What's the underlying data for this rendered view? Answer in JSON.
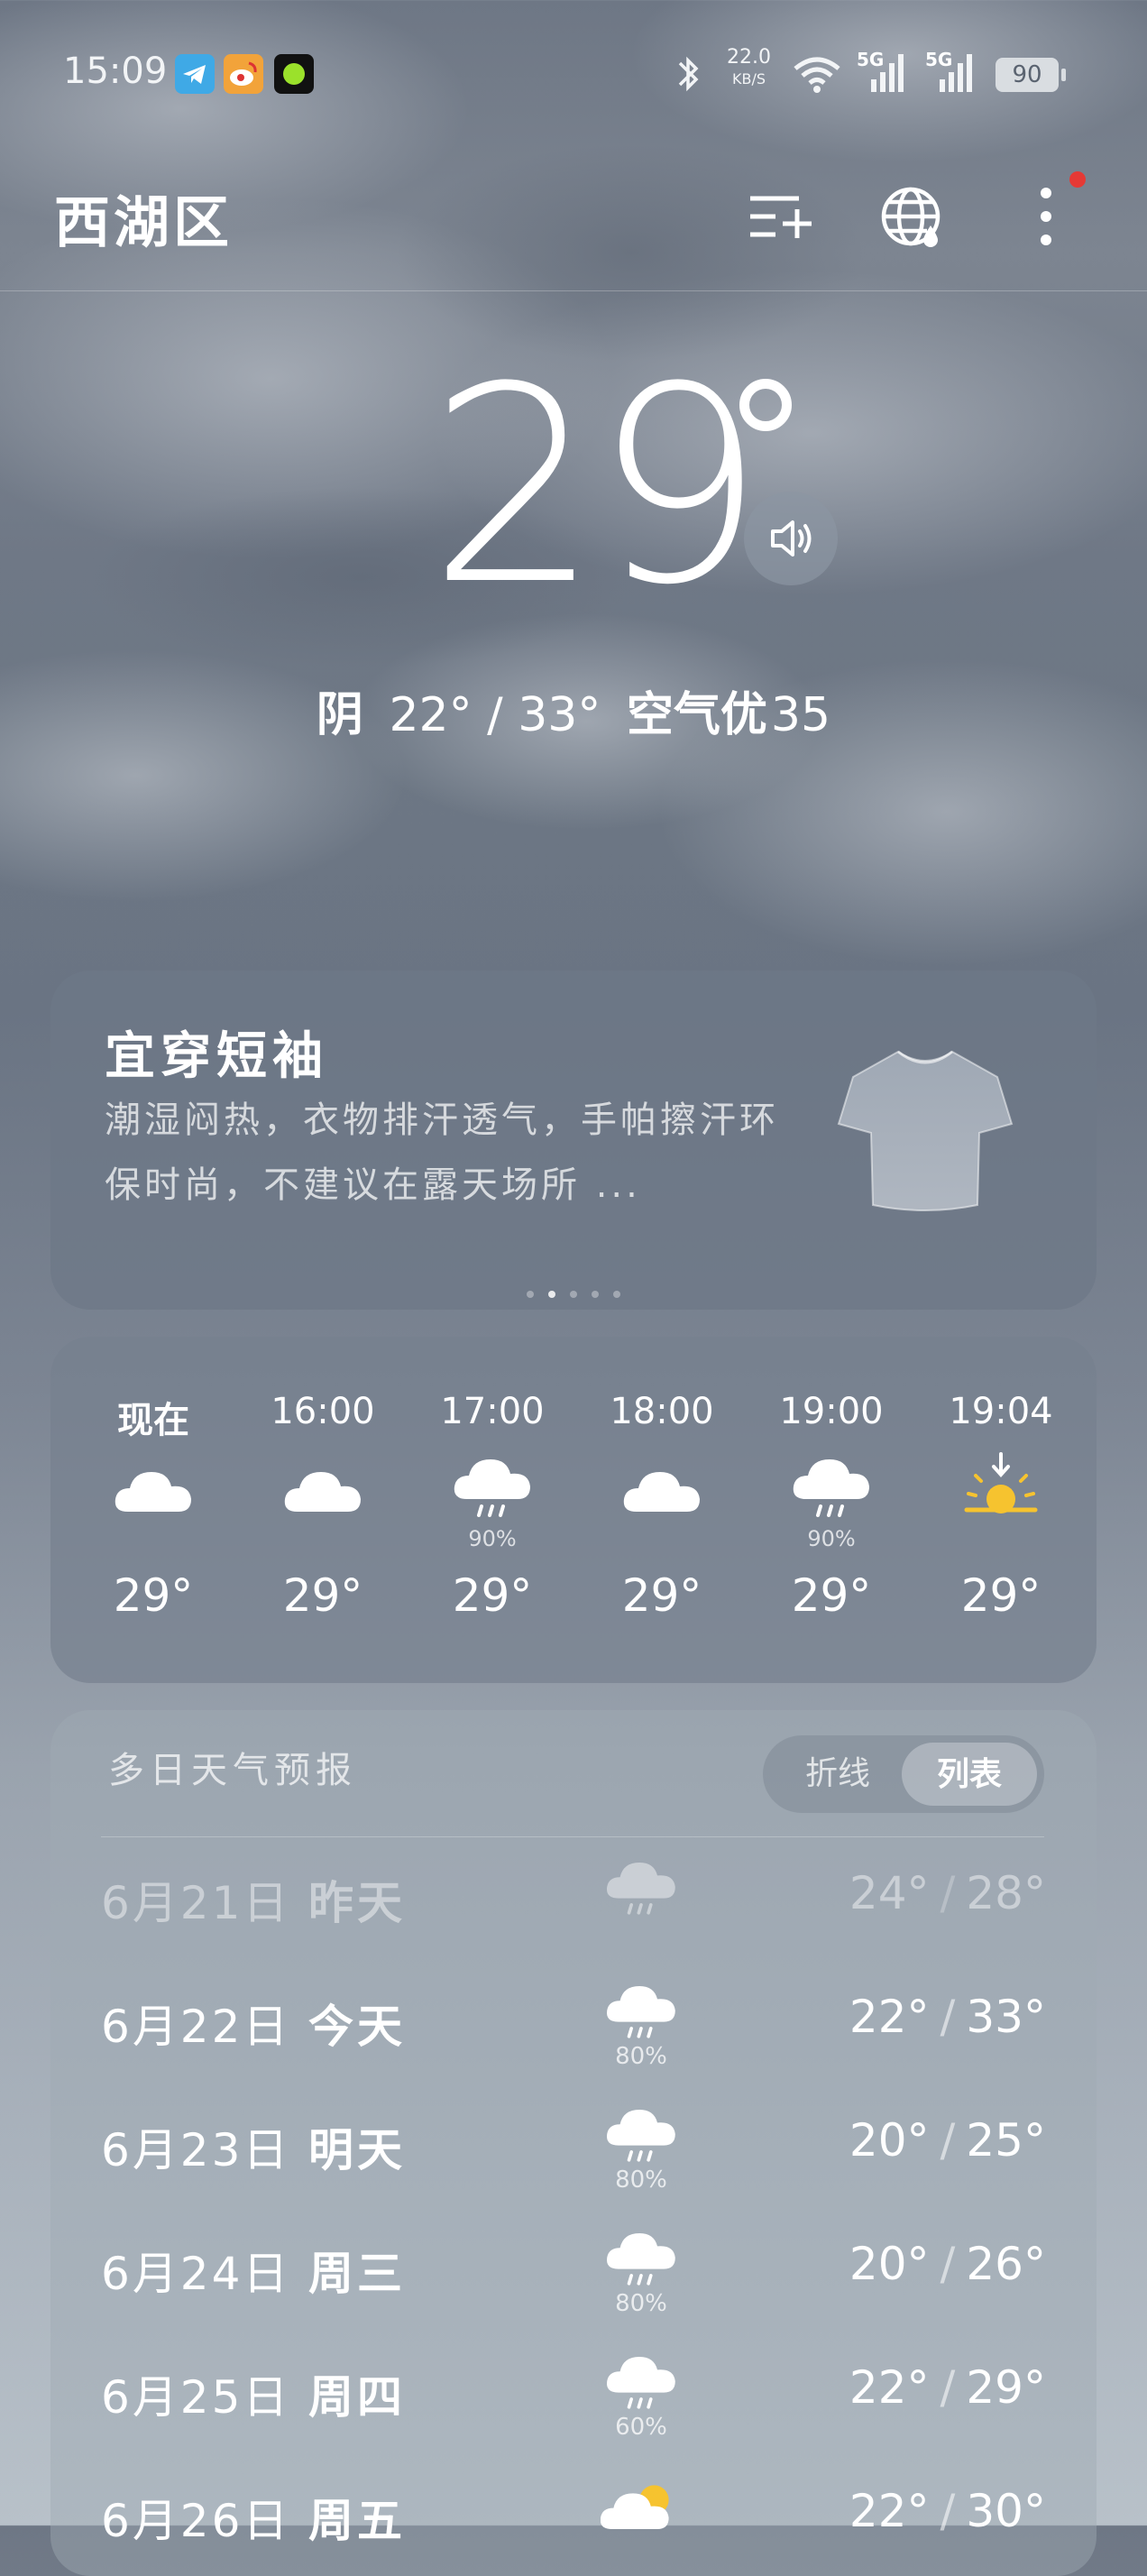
{
  "status_bar": {
    "time": "15:09",
    "net_speed_value": "22.0",
    "net_speed_unit": "KB/S",
    "signal_1_label": "5G",
    "signal_2_label": "5G",
    "battery": "90"
  },
  "header": {
    "city": "西湖区"
  },
  "current": {
    "temperature": "29",
    "condition": "阴",
    "range": "22° / 33°",
    "aqi_label": "空气优",
    "aqi_value": "35"
  },
  "clothing_card": {
    "title": "宜穿短袖",
    "description": "潮湿闷热，衣物排汗透气，手帕擦汗环保时尚，不建议在露天场所 ...",
    "page_count": 5,
    "active_page": 2
  },
  "hourly": [
    {
      "label": "现在",
      "icon": "cloud-icon",
      "prob": "",
      "temp": "29°"
    },
    {
      "label": "16:00",
      "icon": "cloud-icon",
      "prob": "",
      "temp": "29°"
    },
    {
      "label": "17:00",
      "icon": "rain-icon",
      "prob": "90%",
      "temp": "29°"
    },
    {
      "label": "18:00",
      "icon": "cloud-icon",
      "prob": "",
      "temp": "29°"
    },
    {
      "label": "19:00",
      "icon": "rain-icon",
      "prob": "90%",
      "temp": "29°"
    },
    {
      "label": "19:04",
      "icon": "sunset-icon",
      "prob": "",
      "temp": "29°"
    }
  ],
  "forecast": {
    "title": "多日天气预报",
    "toggle_line": "折线",
    "toggle_list": "列表",
    "days": [
      {
        "date": "6月21日",
        "day": "昨天",
        "icon": "rain-icon",
        "prob": "",
        "low": "24°",
        "high": "28°"
      },
      {
        "date": "6月22日",
        "day": "今天",
        "icon": "rain-icon",
        "prob": "80%",
        "low": "22°",
        "high": "33°"
      },
      {
        "date": "6月23日",
        "day": "明天",
        "icon": "rain-icon",
        "prob": "80%",
        "low": "20°",
        "high": "25°"
      },
      {
        "date": "6月24日",
        "day": "周三",
        "icon": "rain-icon",
        "prob": "80%",
        "low": "20°",
        "high": "26°"
      },
      {
        "date": "6月25日",
        "day": "周四",
        "icon": "rain-icon",
        "prob": "60%",
        "low": "22°",
        "high": "29°"
      },
      {
        "date": "6月26日",
        "day": "周五",
        "icon": "partly-cloudy-icon",
        "prob": "",
        "low": "22°",
        "high": "30°"
      }
    ]
  },
  "colors": {
    "sun": "#f6c32f",
    "notification_dot": "#e53935"
  }
}
